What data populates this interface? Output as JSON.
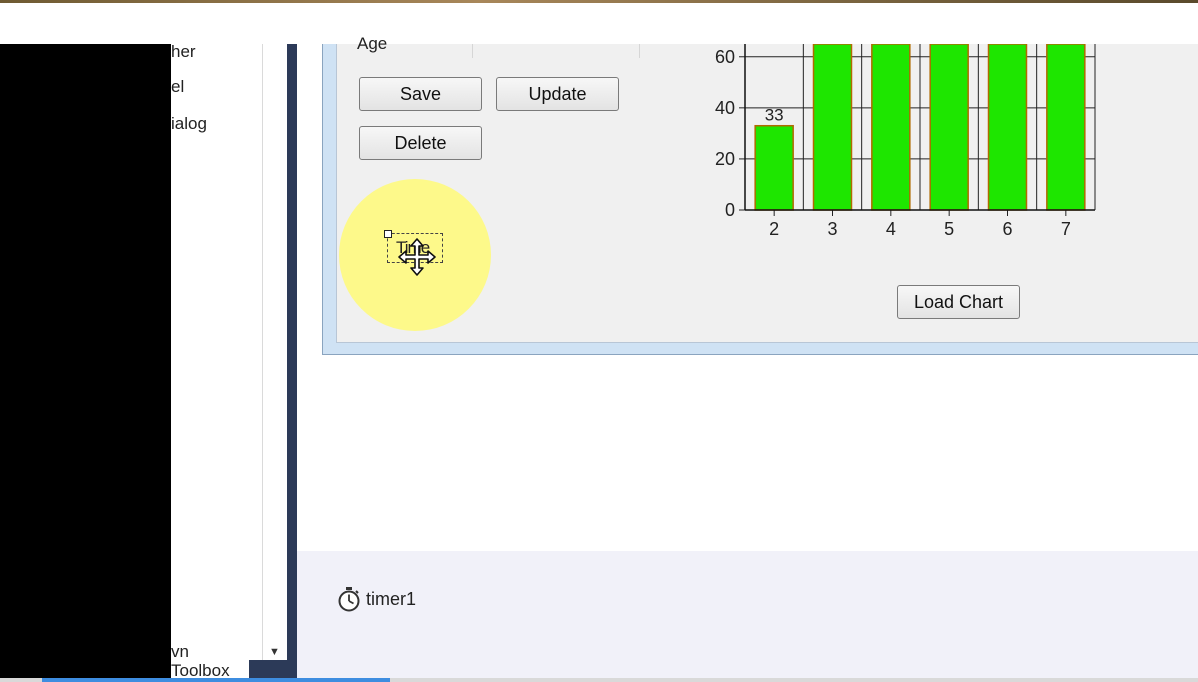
{
  "toolbox": {
    "items": [
      {
        "label": "her"
      },
      {
        "label": "el"
      },
      {
        "label": "ialog"
      },
      {
        "label": "vn"
      }
    ],
    "tab_label": "Toolbox"
  },
  "form": {
    "age_label": "Age",
    "buttons": {
      "save": "Save",
      "update": "Update",
      "delete": "Delete",
      "load_chart": "Load Chart"
    },
    "timer_control_label": "Time"
  },
  "tray": {
    "timer_label": "timer1"
  },
  "colors": {
    "bar_fill": "#1ee600",
    "bar_border": "#b06a00",
    "highlight": "#fff878",
    "designer_sep": "#2c3a58"
  },
  "chart_data": {
    "type": "bar",
    "categories": [
      "2",
      "3",
      "4",
      "5",
      "6",
      "7"
    ],
    "values": [
      33,
      80,
      80,
      80,
      80,
      80
    ],
    "data_labels": [
      "33",
      "",
      "",
      "",
      "",
      ""
    ],
    "y_ticks": [
      "0",
      "20",
      "40",
      "60"
    ],
    "ylim": [
      0,
      65
    ],
    "grid": true,
    "title": "",
    "xlabel": "",
    "ylabel": ""
  }
}
